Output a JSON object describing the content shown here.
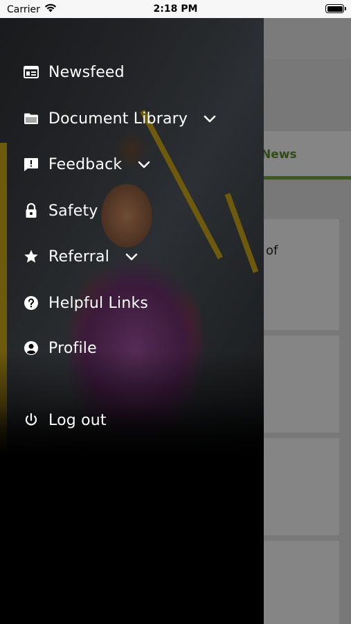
{
  "status_bar": {
    "carrier": "Carrier",
    "time": "2:18 PM"
  },
  "background_screen": {
    "tab_label": "News",
    "card_text": "of",
    "accent_color": "#7aa935"
  },
  "menu": {
    "items": [
      {
        "label": "Newsfeed",
        "icon": "newsfeed-icon",
        "has_chevron": false
      },
      {
        "label": "Document Library",
        "icon": "folder-icon",
        "has_chevron": true
      },
      {
        "label": "Feedback",
        "icon": "feedback-icon",
        "has_chevron": true
      },
      {
        "label": "Safety",
        "icon": "lock-icon",
        "has_chevron": false
      },
      {
        "label": "Referral",
        "icon": "star-icon",
        "has_chevron": true
      },
      {
        "label": "Helpful Links",
        "icon": "help-icon",
        "has_chevron": false
      },
      {
        "label": "Profile",
        "icon": "account-icon",
        "has_chevron": false
      },
      {
        "label": "Log out",
        "icon": "power-icon",
        "has_chevron": false
      }
    ]
  }
}
